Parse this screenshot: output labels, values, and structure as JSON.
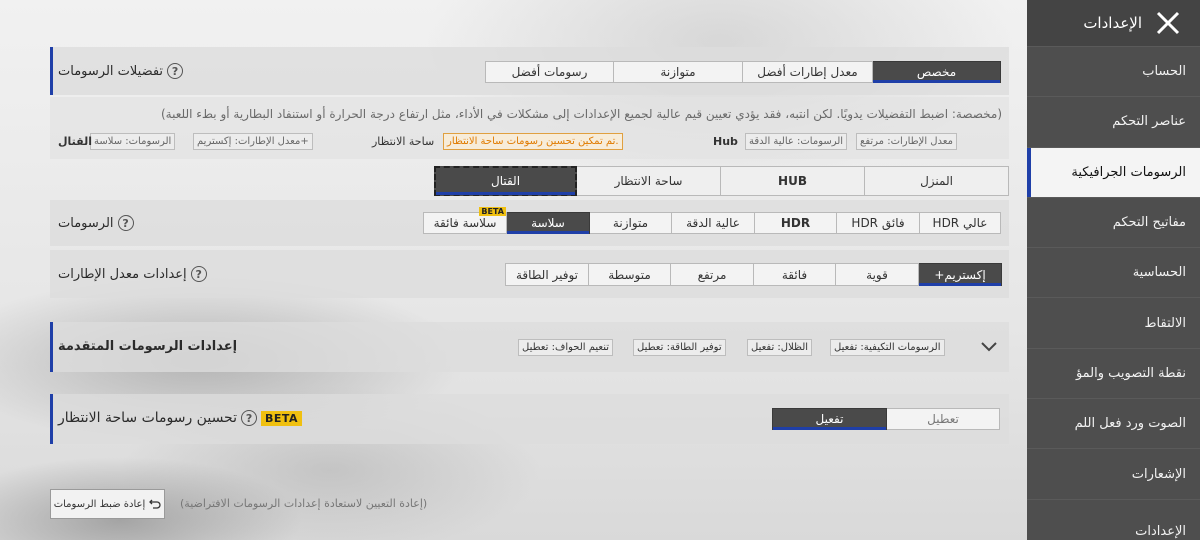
{
  "sidebar": {
    "title": "الإعدادات",
    "items": [
      {
        "label": "الحساب",
        "active": false
      },
      {
        "label": "عناصر التحكم",
        "active": false
      },
      {
        "label": "الرسومات الجرافيكية",
        "active": true
      },
      {
        "label": "مفاتيح التحكم",
        "active": false
      },
      {
        "label": "الحساسية",
        "active": false
      },
      {
        "label": "الالتقاط",
        "active": false
      },
      {
        "label": "نقطة التصويب والمؤ",
        "active": false
      },
      {
        "label": "الصوت ورد فعل اللم",
        "active": false
      },
      {
        "label": "الإشعارات",
        "active": false
      },
      {
        "label": "الإعدادات",
        "active": false
      }
    ]
  },
  "preferences": {
    "title": "تفضيلات الرسومات",
    "options": [
      "مخصص",
      "معدل إطارات أفضل",
      "متوازنة",
      "رسومات أفضل"
    ],
    "selected": "مخصص",
    "description": "(مخصصة: اضبط التفضيلات يدويًا. لكن انتبه، فقد يؤدي تعيين قيم عالية لجميع الإعدادات إلى مشكلات في الأداء، مثل ارتفاع درجة الحرارة أو استنفاد البطارية أو بطء اللعبة)",
    "hub_label": "Hub",
    "hub_tags": [
      "معدل الإطارات: مرتفع",
      "الرسومات: عالية الدقة"
    ],
    "lobby_label": "ساحة الانتظار",
    "lobby_notice": "تم تمكين تحسين رسومات ساحة الانتظار.",
    "combat_label": "القتال",
    "combat_tags": [
      "معدل الإطارات: إكستريم+",
      "الرسومات: سلاسة"
    ]
  },
  "scene_tabs": {
    "options": [
      "المنزل",
      "HUB",
      "ساحة الانتظار",
      "القتال"
    ],
    "selected": "القتال"
  },
  "graphics": {
    "label": "الرسومات",
    "options": [
      "عالي HDR",
      "فائق HDR",
      "HDR",
      "عالية الدقة",
      "متوازنة",
      "سلاسة",
      "سلاسة فائقة"
    ],
    "selected": "سلاسة",
    "beta_label": "BETA"
  },
  "framerate": {
    "label": "إعدادات معدل الإطارات",
    "options": [
      "إكستريم+",
      "قوية",
      "فائقة",
      "مرتفع",
      "متوسطة",
      "توفير الطاقة"
    ],
    "selected": "إكستريم+"
  },
  "advanced": {
    "title": "إعدادات الرسومات المتقدمة",
    "tags": [
      "الرسومات التكيفية: تفعيل",
      "الظلال: تفعيل",
      "توفير الطاقة: تعطيل",
      "تنعيم الحواف: تعطيل"
    ]
  },
  "lobby_enhance": {
    "title": "تحسين رسومات ساحة الانتظار",
    "beta_label": "BETA",
    "options": [
      "تعطيل",
      "تفعيل"
    ],
    "selected": "تفعيل"
  },
  "reset": {
    "button_label": "إعادة ضبط الرسومات",
    "hint": "(إعادة التعيين لاستعادة إعدادات الرسومات الافتراضية)"
  },
  "colors": {
    "accent": "#1f3fa8",
    "notice": "#e07b00",
    "beta": "#f0c010"
  }
}
